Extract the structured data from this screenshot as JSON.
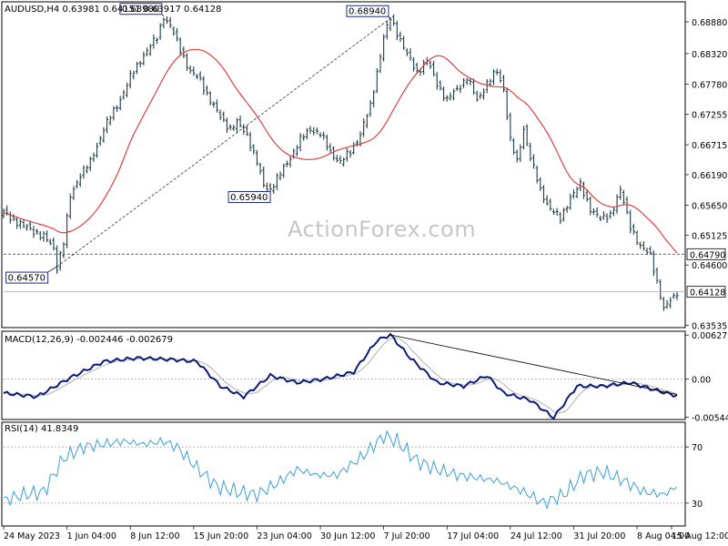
{
  "header": {
    "price_title": "AUDUSD,H4  0.63981 0.64151 0.63917 0.64128",
    "macd_title": "MACD(12,26,9) -0.002446 -0.002679",
    "rsi_title": "RSI(14) 41.8349",
    "watermark": "ActionForex.com"
  },
  "chart_data": [
    {
      "type": "line",
      "name": "price",
      "y_ticks": [
        "0.68880",
        "0.68320",
        "0.67780",
        "0.67255",
        "0.66715",
        "0.66190",
        "0.65650",
        "0.65125",
        "0.64790",
        "0.64600",
        "0.64128",
        "0.63535"
      ],
      "ylim": [
        0.6353,
        0.692
      ],
      "current_price": 0.64128,
      "current_price_label": "0.64128",
      "support_line": 0.6479,
      "support_line_label": "0.64790",
      "annotations": [
        {
          "label": "0.64570",
          "value": 0.6457
        },
        {
          "label": "0.68980",
          "value": 0.6898
        },
        {
          "label": "0.65940",
          "value": 0.6594
        },
        {
          "label": "0.68940",
          "value": 0.6894
        }
      ],
      "x_labels": [
        "24 May 2023",
        "1 Jun 04:00",
        "8 Jun 12:00",
        "15 Jun 20:00",
        "23 Jun 04:00",
        "30 Jun 12:00",
        "7 Jul 20:00",
        "17 Jul 04:00",
        "24 Jul 12:00",
        "31 Jul 20:00",
        "8 Aug 04:00",
        "15 Aug 12:00"
      ],
      "close_path": [
        [
          0,
          0.6552
        ],
        [
          3,
          0.654
        ],
        [
          6,
          0.6528
        ],
        [
          9,
          0.652
        ],
        [
          12,
          0.651
        ],
        [
          15,
          0.649
        ],
        [
          16,
          0.6457
        ],
        [
          18,
          0.65
        ],
        [
          20,
          0.658
        ],
        [
          23,
          0.662
        ],
        [
          26,
          0.664
        ],
        [
          30,
          0.67
        ],
        [
          34,
          0.674
        ],
        [
          38,
          0.679
        ],
        [
          42,
          0.683
        ],
        [
          46,
          0.686
        ],
        [
          48,
          0.6898
        ],
        [
          50,
          0.688
        ],
        [
          53,
          0.684
        ],
        [
          56,
          0.68
        ],
        [
          59,
          0.6785
        ],
        [
          62,
          0.675
        ],
        [
          65,
          0.672
        ],
        [
          68,
          0.67
        ],
        [
          70,
          0.671
        ],
        [
          73,
          0.669
        ],
        [
          76,
          0.664
        ],
        [
          78,
          0.66
        ],
        [
          80,
          0.6594
        ],
        [
          83,
          0.662
        ],
        [
          86,
          0.665
        ],
        [
          89,
          0.668
        ],
        [
          92,
          0.67
        ],
        [
          95,
          0.669
        ],
        [
          98,
          0.666
        ],
        [
          101,
          0.664
        ],
        [
          104,
          0.666
        ],
        [
          107,
          0.669
        ],
        [
          110,
          0.674
        ],
        [
          112,
          0.68
        ],
        [
          114,
          0.686
        ],
        [
          116,
          0.6894
        ],
        [
          118,
          0.687
        ],
        [
          121,
          0.683
        ],
        [
          124,
          0.68
        ],
        [
          127,
          0.682
        ],
        [
          130,
          0.678
        ],
        [
          133,
          0.675
        ],
        [
          136,
          0.677
        ],
        [
          139,
          0.679
        ],
        [
          142,
          0.675
        ],
        [
          145,
          0.678
        ],
        [
          148,
          0.68
        ],
        [
          150,
          0.677
        ],
        [
          152,
          0.668
        ],
        [
          154,
          0.664
        ],
        [
          156,
          0.67
        ],
        [
          158,
          0.665
        ],
        [
          161,
          0.659
        ],
        [
          164,
          0.656
        ],
        [
          167,
          0.654
        ],
        [
          170,
          0.658
        ],
        [
          173,
          0.66
        ],
        [
          176,
          0.656
        ],
        [
          179,
          0.654
        ],
        [
          182,
          0.655
        ],
        [
          185,
          0.659
        ],
        [
          188,
          0.653
        ],
        [
          191,
          0.649
        ],
        [
          194,
          0.648
        ],
        [
          196,
          0.643
        ],
        [
          198,
          0.638
        ],
        [
          200,
          0.64
        ],
        [
          202,
          0.6413
        ]
      ]
    },
    {
      "type": "line",
      "name": "MACD(12,26,9)",
      "value": -0.002446,
      "signal": -0.002679,
      "y_ticks": [
        "0.006275",
        "0.00",
        "-0.005446"
      ],
      "ylim": [
        -0.0055,
        0.0063
      ],
      "path": [
        [
          0,
          -0.002
        ],
        [
          10,
          -0.0025
        ],
        [
          20,
          0.0002
        ],
        [
          30,
          0.0025
        ],
        [
          40,
          0.003
        ],
        [
          50,
          0.0028
        ],
        [
          58,
          0.0025
        ],
        [
          65,
          -0.001
        ],
        [
          72,
          -0.0025
        ],
        [
          80,
          0.0005
        ],
        [
          88,
          -0.0005
        ],
        [
          96,
          0.0
        ],
        [
          105,
          0.001
        ],
        [
          112,
          0.0055
        ],
        [
          116,
          0.0063
        ],
        [
          122,
          0.003
        ],
        [
          130,
          -0.0005
        ],
        [
          138,
          -0.001
        ],
        [
          145,
          0.0005
        ],
        [
          150,
          -0.002
        ],
        [
          158,
          -0.003
        ],
        [
          165,
          -0.0055
        ],
        [
          172,
          -0.001
        ],
        [
          180,
          -0.001
        ],
        [
          188,
          -0.0005
        ],
        [
          195,
          -0.0015
        ],
        [
          202,
          -0.0024
        ]
      ]
    },
    {
      "type": "line",
      "name": "RSI(14)",
      "value": 41.8349,
      "y_ticks": [
        "70",
        "30"
      ],
      "ylim": [
        15,
        85
      ],
      "path": [
        [
          0,
          32
        ],
        [
          6,
          36
        ],
        [
          12,
          38
        ],
        [
          18,
          62
        ],
        [
          24,
          70
        ],
        [
          30,
          72
        ],
        [
          36,
          74
        ],
        [
          42,
          72
        ],
        [
          48,
          74
        ],
        [
          52,
          70
        ],
        [
          58,
          55
        ],
        [
          64,
          42
        ],
        [
          70,
          38
        ],
        [
          76,
          36
        ],
        [
          82,
          44
        ],
        [
          88,
          54
        ],
        [
          94,
          50
        ],
        [
          100,
          50
        ],
        [
          108,
          64
        ],
        [
          114,
          78
        ],
        [
          118,
          74
        ],
        [
          124,
          60
        ],
        [
          130,
          54
        ],
        [
          136,
          50
        ],
        [
          142,
          48
        ],
        [
          148,
          46
        ],
        [
          152,
          42
        ],
        [
          156,
          38
        ],
        [
          162,
          30
        ],
        [
          168,
          36
        ],
        [
          174,
          50
        ],
        [
          180,
          52
        ],
        [
          186,
          46
        ],
        [
          192,
          38
        ],
        [
          198,
          36
        ],
        [
          202,
          42
        ]
      ]
    }
  ]
}
